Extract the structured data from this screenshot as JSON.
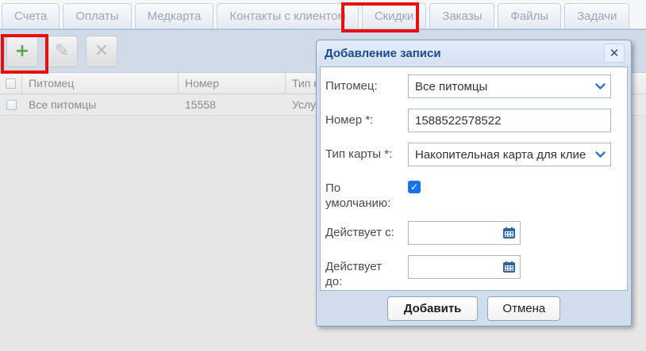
{
  "tabs": [
    "Счета",
    "Оплаты",
    "Медкарта",
    "Контакты с клиентом",
    "Скидки",
    "Заказы",
    "Файлы",
    "Задачи"
  ],
  "toolbar": {
    "add_icon": "+",
    "edit_icon": "✎",
    "delete_icon": "✕"
  },
  "table": {
    "columns": {
      "pet": "Питомец",
      "number": "Номер",
      "type": "Тип к"
    },
    "row": {
      "pet": "Все питомцы",
      "number": "15558",
      "type": "Услу"
    }
  },
  "dialog": {
    "title": "Добавление записи",
    "close_icon": "✕",
    "fields": {
      "pet": {
        "label": "Питомец:",
        "value": "Все питомцы"
      },
      "number": {
        "label": "Номер *:",
        "value": "1588522578522"
      },
      "card_type": {
        "label": "Тип карты *:",
        "value": "Накопительная карта для клие"
      },
      "default": {
        "label": "По\nумолчанию:",
        "checked": true,
        "check_icon": "✓"
      },
      "valid_from": {
        "label": "Действует с:",
        "value": ""
      },
      "valid_to": {
        "label": "Действует\nдо:",
        "value": ""
      }
    },
    "buttons": {
      "submit": "Добавить",
      "cancel": "Отмена"
    }
  },
  "annotations": {
    "highlight_color": "#e8100c",
    "highlighted_tab": "Скидки",
    "highlighted_button": "add"
  },
  "colors": {
    "toolbar_bg": "#d1dbe8",
    "dialog_frame": "#cfdded",
    "title_text": "#1a4a8a",
    "accent_blue": "#3a70b5",
    "checkbox_blue": "#1a73e8",
    "add_green": "#4fa84f"
  }
}
